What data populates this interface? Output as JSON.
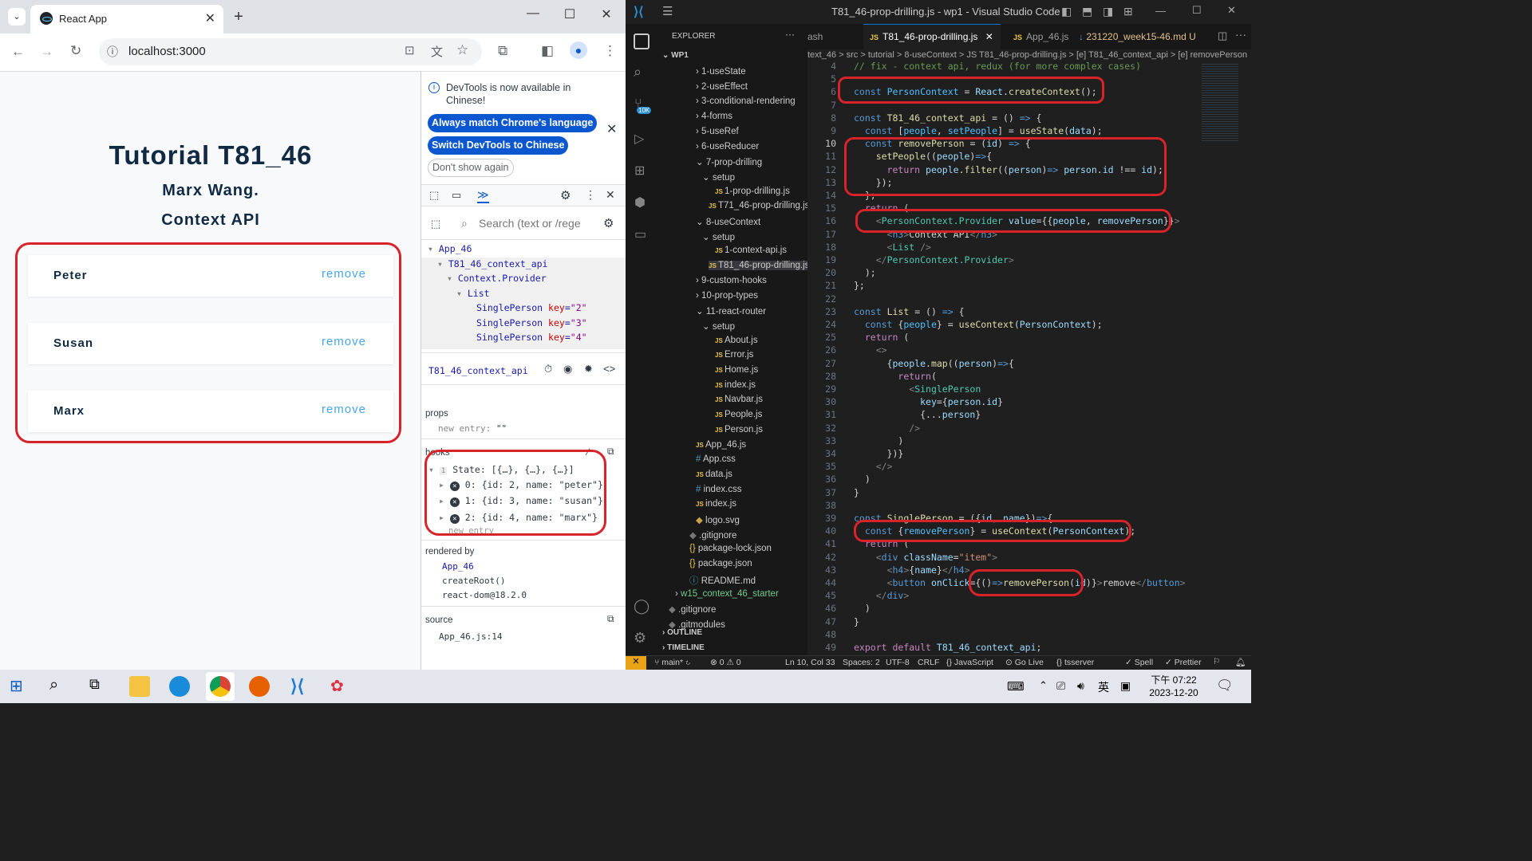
{
  "browser": {
    "tab_title": "React App",
    "url": "localhost:3000"
  },
  "app": {
    "title": "Tutorial T81_46",
    "author": "Marx Wang.",
    "subtitle": "Context API",
    "people": [
      {
        "name": "Peter",
        "action": "remove"
      },
      {
        "name": "Susan",
        "action": "remove"
      },
      {
        "name": "Marx",
        "action": "remove"
      }
    ]
  },
  "devtools": {
    "notice": "DevTools is now available in Chinese!",
    "btn_match": "Always match Chrome's language",
    "btn_switch": "Switch DevTools to Chinese",
    "btn_dont": "Don't show again",
    "search_placeholder": "Search (text or /rege",
    "tree": [
      {
        "label": "App_46",
        "indent": 0
      },
      {
        "label": "T81_46_context_api",
        "indent": 1
      },
      {
        "label": "Context.Provider",
        "indent": 2
      },
      {
        "label": "List",
        "indent": 3
      },
      {
        "label": "SinglePerson",
        "key": "2",
        "indent": 4
      },
      {
        "label": "SinglePerson",
        "key": "3",
        "indent": 4
      },
      {
        "label": "SinglePerson",
        "key": "4",
        "indent": 4
      }
    ],
    "selected": "T81_46_context_api",
    "props_label": "props",
    "new_entry": "new entry:",
    "new_entry_val": "\"\"",
    "hooks_label": "hooks",
    "state_line": "State: [{…}, {…}, {…}]",
    "state_items": [
      "0: {id: 2, name: \"peter\"}",
      "1: {id: 3, name: \"susan\"}",
      "2: {id: 4, name: \"marx\"}"
    ],
    "new_entry2": "new entry",
    "rendered_by_label": "rendered by",
    "rendered_by": [
      "App_46",
      "createRoot()",
      "react-dom@18.2.0"
    ],
    "source_label": "source",
    "source": "App_46.js:14"
  },
  "vscode": {
    "title": "T81_46-prop-drilling.js - wp1 - Visual Studio Code",
    "explorer_label": "EXPLORER",
    "root": "WP1",
    "tabs": [
      "ash",
      "T81_46-prop-drilling.js",
      "App_46.js",
      "231220_week15-46.md U"
    ],
    "breadcrumb": "text_46 > src > tutorial > 8-useContext > JS T81_46-prop-drilling.js > [e] T81_46_context_api > [e] removePerson",
    "files": [
      {
        "t": "1-useState",
        "d": 2,
        "k": "folder"
      },
      {
        "t": "2-useEffect",
        "d": 2,
        "k": "folder"
      },
      {
        "t": "3-conditional-rendering",
        "d": 2,
        "k": "folder"
      },
      {
        "t": "4-forms",
        "d": 2,
        "k": "folder"
      },
      {
        "t": "5-useRef",
        "d": 2,
        "k": "folder"
      },
      {
        "t": "6-useReducer",
        "d": 2,
        "k": "folder"
      },
      {
        "t": "7-prop-drilling",
        "d": 2,
        "k": "open"
      },
      {
        "t": "setup",
        "d": 3,
        "k": "open"
      },
      {
        "t": "1-prop-drilling.js",
        "d": 4,
        "k": "js"
      },
      {
        "t": "T71_46-prop-drilling.js",
        "d": 3,
        "k": "js"
      },
      {
        "t": "8-useContext",
        "d": 2,
        "k": "open"
      },
      {
        "t": "setup",
        "d": 3,
        "k": "open"
      },
      {
        "t": "1-context-api.js",
        "d": 4,
        "k": "js"
      },
      {
        "t": "T81_46-prop-drilling.js",
        "d": 3,
        "k": "js"
      },
      {
        "t": "9-custom-hooks",
        "d": 2,
        "k": "folder"
      },
      {
        "t": "10-prop-types",
        "d": 2,
        "k": "folder"
      },
      {
        "t": "11-react-router",
        "d": 2,
        "k": "open"
      },
      {
        "t": "setup",
        "d": 3,
        "k": "open"
      },
      {
        "t": "About.js",
        "d": 4,
        "k": "js"
      },
      {
        "t": "Error.js",
        "d": 4,
        "k": "js"
      },
      {
        "t": "Home.js",
        "d": 4,
        "k": "js"
      },
      {
        "t": "index.js",
        "d": 4,
        "k": "js"
      },
      {
        "t": "Navbar.js",
        "d": 4,
        "k": "js"
      },
      {
        "t": "People.js",
        "d": 4,
        "k": "js"
      },
      {
        "t": "Person.js",
        "d": 4,
        "k": "js"
      },
      {
        "t": "App_46.js",
        "d": 1,
        "k": "js"
      },
      {
        "t": "App.css",
        "d": 1,
        "k": "css"
      },
      {
        "t": "data.js",
        "d": 1,
        "k": "js"
      },
      {
        "t": "index.css",
        "d": 1,
        "k": "css"
      },
      {
        "t": "index.js",
        "d": 1,
        "k": "js"
      },
      {
        "t": "logo.svg",
        "d": 1,
        "k": "svg"
      },
      {
        "t": ".gitignore",
        "d": 0,
        "k": "git"
      },
      {
        "t": "package-lock.json",
        "d": 0,
        "k": "json"
      },
      {
        "t": "package.json",
        "d": 0,
        "k": "json"
      },
      {
        "t": "README.md",
        "d": 0,
        "k": "md"
      },
      {
        "t": "w15_context_46_starter",
        "d": -1,
        "k": "folder"
      },
      {
        "t": ".gitignore",
        "d": -2,
        "k": "git"
      },
      {
        "t": ".gitmodules",
        "d": -2,
        "k": "git"
      }
    ],
    "outline": "OUTLINE",
    "timeline": "TIMELINE",
    "status": {
      "branch": "main*",
      "errors": "⊗ 0 ⚠ 0",
      "pos": "Ln 10, Col 33",
      "spaces": "Spaces: 2",
      "enc": "UTF-8",
      "eol": "CRLF",
      "lang": "{} JavaScript",
      "golive": "Go Live",
      "tsserver": "tsserver",
      "spell": "Spell",
      "prettier": "Prettier"
    }
  },
  "taskbar": {
    "time": "下午 07:22",
    "date": "2023-12-20",
    "ime": "英"
  }
}
